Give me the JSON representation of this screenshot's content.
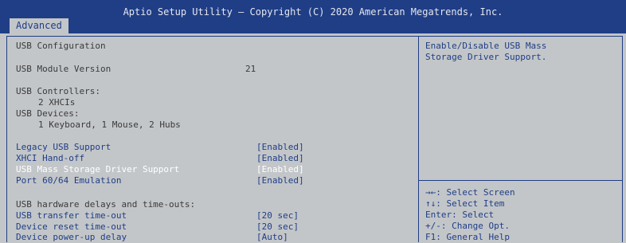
{
  "header": {
    "title": "Aptio Setup Utility – Copyright (C) 2020 American Megatrends, Inc.",
    "tab_label": "Advanced"
  },
  "main": {
    "section_title": "USB Configuration",
    "module_version": {
      "label": "USB Module Version",
      "value": "21"
    },
    "controllers_label": "USB Controllers:",
    "controllers_value": "2 XHCIs",
    "devices_label": "USB Devices:",
    "devices_value": "1 Keyboard, 1 Mouse, 2 Hubs",
    "options": [
      {
        "label": "Legacy USB Support",
        "value": "[Enabled]"
      },
      {
        "label": "XHCI Hand-off",
        "value": "[Enabled]"
      },
      {
        "label": "USB Mass Storage Driver Support",
        "value": "[Enabled]"
      },
      {
        "label": "Port 60/64 Emulation",
        "value": "[Enabled]"
      }
    ],
    "delays_title": "USB hardware delays and time-outs:",
    "delay_options": [
      {
        "label": "USB transfer time-out",
        "value": "[20 sec]"
      },
      {
        "label": "Device reset time-out",
        "value": "[20 sec]"
      },
      {
        "label": "Device power-up delay",
        "value": "[Auto]"
      }
    ]
  },
  "help": {
    "line1": "Enable/Disable USB Mass",
    "line2": "Storage Driver Support."
  },
  "keys": [
    "→←: Select Screen",
    "↑↓: Select Item",
    "Enter: Select",
    "+/-: Change Opt.",
    "F1: General Help"
  ],
  "colors": {
    "title_bar": "#1f3e86",
    "background": "#c3c6c9",
    "selectable_text": "#1f3e86",
    "static_text": "#3a3a3a",
    "selected_text": "#ffffff"
  }
}
